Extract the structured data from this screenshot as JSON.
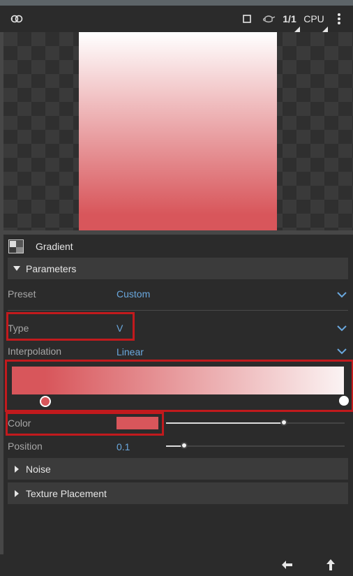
{
  "toolbar": {
    "node_icon": "node-link-icon",
    "frame_icon": "square-frame-icon",
    "teapot_icon": "teapot-icon",
    "ratio": "1/1",
    "engine": "CPU",
    "more_icon": "vertical-dots-icon"
  },
  "preview": {
    "gradient_top": "#ffffff",
    "gradient_bottom": "#d8565b"
  },
  "node": {
    "icon": "gradient-node-icon",
    "title": "Gradient"
  },
  "parameters": {
    "label": "Parameters",
    "expanded": true,
    "preset": {
      "label": "Preset",
      "value": "Custom"
    },
    "type": {
      "label": "Type",
      "value": "V"
    },
    "interpolation": {
      "label": "Interpolation",
      "value": "Linear"
    },
    "ramp": {
      "stops": [
        {
          "position": 0.1,
          "color": "#d8565b",
          "selected": true
        },
        {
          "position": 1.0,
          "color": "#ffffff",
          "selected": false
        }
      ]
    },
    "color": {
      "label": "Color",
      "value": "#d8565b",
      "slider": 0.66
    },
    "position": {
      "label": "Position",
      "value": "0.1",
      "slider": 0.1
    }
  },
  "sections": {
    "noise": "Noise",
    "texture_placement": "Texture Placement"
  },
  "bottom": {
    "left_icon": "arrow-left-icon",
    "up_icon": "arrow-up-icon"
  },
  "colors": {
    "accent_value": "#6aa8de",
    "highlight": "#c21a1d",
    "background": "#2b2b2b"
  }
}
